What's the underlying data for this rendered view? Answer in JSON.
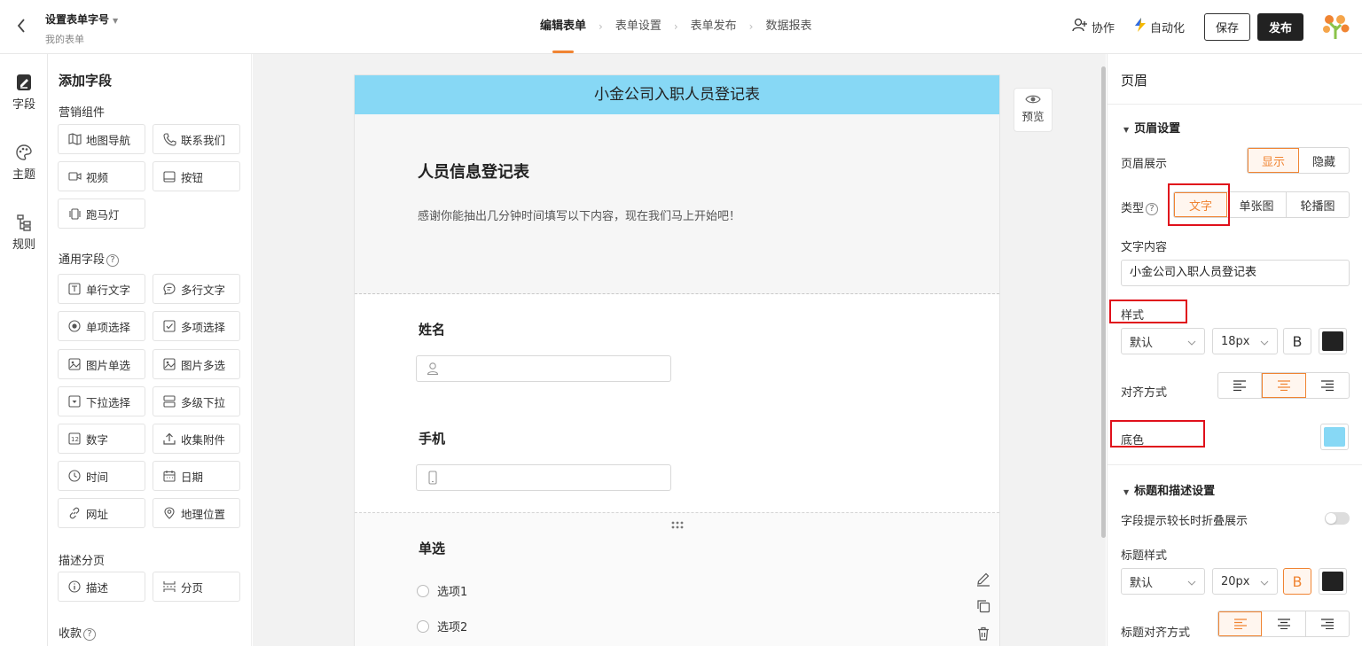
{
  "header": {
    "form_name": "设置表单字号",
    "breadcrumb": "我的表单",
    "steps": [
      "编辑表单",
      "表单设置",
      "表单发布",
      "数据报表"
    ],
    "collab_label": "协作",
    "automation_label": "自动化",
    "save_label": "保存",
    "publish_label": "发布"
  },
  "rail": [
    {
      "label": "字段",
      "icon": "edit-doc-icon"
    },
    {
      "label": "主题",
      "icon": "palette-icon"
    },
    {
      "label": "规则",
      "icon": "flow-icon"
    }
  ],
  "field_panel": {
    "title": "添加字段",
    "sections": {
      "marketing": "营销组件",
      "general": "通用字段",
      "paging": "描述分页",
      "payment": "收款"
    },
    "marketing_fields": [
      {
        "label": "地图导航",
        "icon": "map-icon"
      },
      {
        "label": "联系我们",
        "icon": "phone-icon"
      },
      {
        "label": "视频",
        "icon": "video-icon"
      },
      {
        "label": "按钮",
        "icon": "button-icon"
      },
      {
        "label": "跑马灯",
        "icon": "marquee-icon"
      }
    ],
    "general_fields": [
      {
        "label": "单行文字",
        "icon": "text-icon"
      },
      {
        "label": "多行文字",
        "icon": "multiline-icon"
      },
      {
        "label": "单项选择",
        "icon": "radio-icon"
      },
      {
        "label": "多项选择",
        "icon": "checkbox-icon"
      },
      {
        "label": "图片单选",
        "icon": "image-icon"
      },
      {
        "label": "图片多选",
        "icon": "image-multi-icon"
      },
      {
        "label": "下拉选择",
        "icon": "dropdown-icon"
      },
      {
        "label": "多级下拉",
        "icon": "cascade-icon"
      },
      {
        "label": "数字",
        "icon": "number-icon"
      },
      {
        "label": "收集附件",
        "icon": "upload-icon"
      },
      {
        "label": "时间",
        "icon": "clock-icon"
      },
      {
        "label": "日期",
        "icon": "calendar-icon"
      },
      {
        "label": "网址",
        "icon": "link-icon"
      },
      {
        "label": "地理位置",
        "icon": "location-icon"
      }
    ],
    "paging_fields": [
      {
        "label": "描述",
        "icon": "info-icon"
      },
      {
        "label": "分页",
        "icon": "pagebreak-icon"
      }
    ]
  },
  "form": {
    "banner_text": "小金公司入职人员登记表",
    "title": "人员信息登记表",
    "description": "感谢你能抽出几分钟时间填写以下内容，现在我们马上开始吧！",
    "questions": {
      "name_label": "姓名",
      "phone_label": "手机",
      "radio_label": "单选",
      "options": [
        "选项1",
        "选项2"
      ]
    },
    "preview_label": "预览"
  },
  "settings": {
    "header": "页眉",
    "header_section": "页眉设置",
    "display_label": "页眉展示",
    "display_options": [
      "显示",
      "隐藏"
    ],
    "display_selected": "显示",
    "type_label": "类型",
    "type_options": [
      "文字",
      "单张图",
      "轮播图"
    ],
    "type_selected": "文字",
    "text_content_label": "文字内容",
    "text_content_value": "小金公司入职人员登记表",
    "style_label": "样式",
    "font_select": "默认",
    "size_select": "18px",
    "bold_glyph": "B",
    "text_color": "#222222",
    "align_label": "对齐方式",
    "align_selected": "center",
    "bg_label": "底色",
    "bg_color": "#87d8f5",
    "title_section": "标题和描述设置",
    "collapse_label": "字段提示较长时折叠展示",
    "collapse_on": false,
    "title_style_label": "标题样式",
    "title_font_select": "默认",
    "title_size_select": "20px",
    "title_color": "#222222",
    "title_align_label": "标题对齐方式",
    "title_align_selected": "left"
  },
  "colors": {
    "accent": "#f08432",
    "highlight_box": "#e0101b"
  }
}
